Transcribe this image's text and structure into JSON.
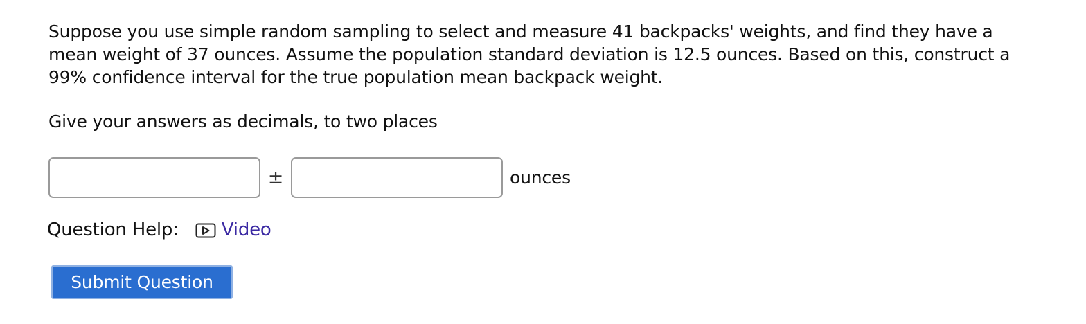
{
  "question": {
    "text": "Suppose you use simple random sampling to select and measure 41 backpacks' weights, and find they have a mean weight of 37 ounces. Assume the population standard deviation is 12.5 ounces. Based on this, construct a 99% confidence interval for the true population mean backpack weight.",
    "instruction": "Give your answers as decimals, to two places"
  },
  "answer": {
    "center_value": "",
    "margin_value": "",
    "plus_minus_symbol": "±",
    "unit_label": "ounces"
  },
  "help": {
    "label": "Question Help:",
    "video_label": "Video",
    "video_icon": "video-play-icon"
  },
  "actions": {
    "submit_label": "Submit Question"
  },
  "colors": {
    "link": "#3b2aa3",
    "submit_background": "#2a6ed0",
    "submit_text": "#ffffff",
    "input_border": "#9a9a9a"
  }
}
